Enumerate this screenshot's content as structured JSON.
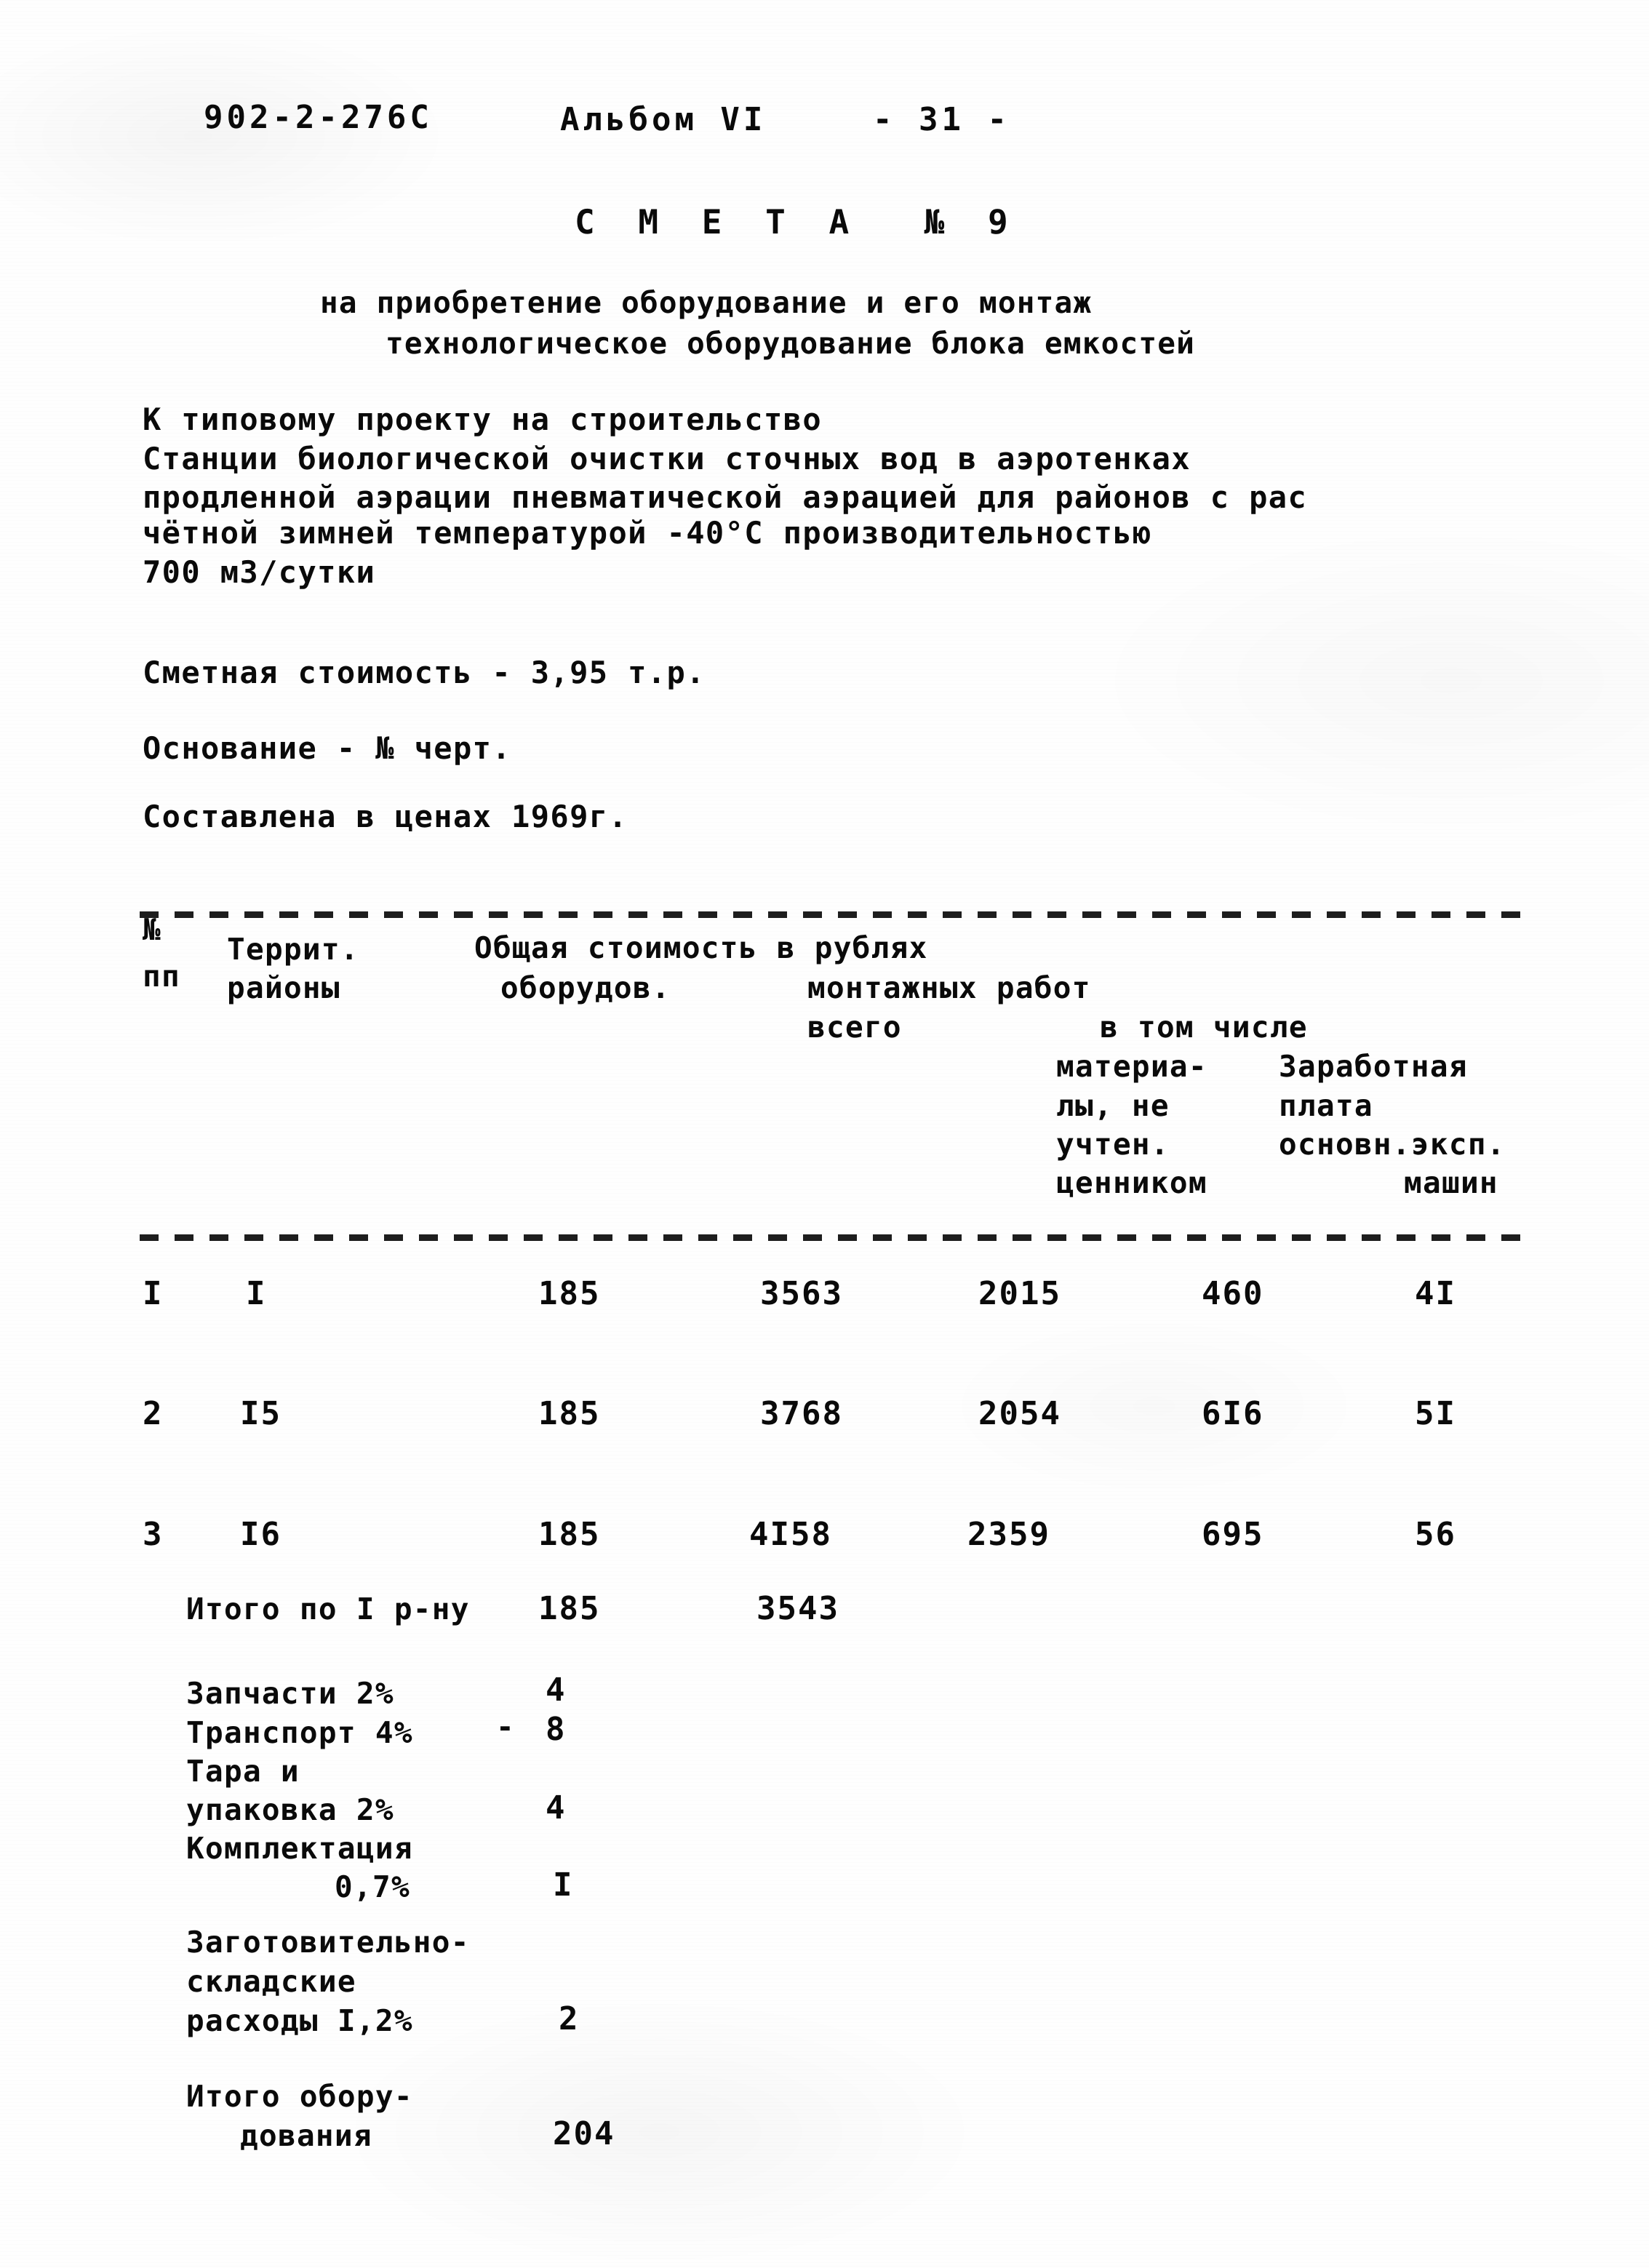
{
  "document": {
    "series_code": "902-2-276С",
    "album_label": "Альбом VI",
    "page_marker": "- 31 -",
    "title": "С М Е Т А  № 9",
    "subtitle_line1": "на приобретение оборудование и его монтаж",
    "subtitle_line2": "технологическое оборудование блока емкостей"
  },
  "preamble": {
    "line1": "К типовому проекту на строительство",
    "line2": "Станции биологической очистки сточных вод в аэротенках",
    "line3": "продленной аэрации пневматической аэрацией для районов с рас",
    "line4": "чётной зимней температурой -40°С производительностью",
    "line5": "700 м3/сутки"
  },
  "summary": {
    "estimate_cost": "Сметная стоимость - 3,95 т.р.",
    "basis": "Основание - № черт.",
    "prices_year": "Составлена в ценах 1969г."
  },
  "table": {
    "headers": {
      "num_line1": "№",
      "num_line2": "пп",
      "region_line1": "Террит.",
      "region_line2": "районы",
      "group_title": "Общая стоимость в рублях",
      "equipment": "оборудов.",
      "install_works": "монтажных работ",
      "total": "всего",
      "among_which": "в том числе",
      "materials_line1": "материа-",
      "materials_line2": "лы, не",
      "materials_line3": "учтен.",
      "materials_line4": "ценником",
      "wages_line1": "Заработная",
      "wages_line2": "плата",
      "wages_line3": "основн.эксп.",
      "wages_line4": "машин"
    },
    "rows": [
      {
        "num": "I",
        "region": "I",
        "equipment": "185",
        "total": "3563",
        "materials": "2015",
        "wages": "460",
        "machines": "4I"
      },
      {
        "num": "2",
        "region": "I5",
        "equipment": "185",
        "total": "3768",
        "materials": "2054",
        "wages": "6I6",
        "machines": "5I"
      },
      {
        "num": "3",
        "region": "I6",
        "equipment": "185",
        "total": "4I58",
        "materials": "2359",
        "wages": "695",
        "machines": "56"
      }
    ],
    "subtotal": {
      "label": "Итого по I р-ну",
      "equipment": "185",
      "total": "3543"
    },
    "additions": [
      {
        "label": "Запчасти 2%",
        "dash": "",
        "value": "4"
      },
      {
        "label": "Транспорт 4%",
        "dash": "-",
        "value": "8"
      },
      {
        "label_line1": "Тара и",
        "label_line2": "упаковка 2%",
        "value": "4"
      },
      {
        "label_line1": "Комплектация",
        "label_line2": "0,7%",
        "value": "I"
      }
    ],
    "procurement": {
      "line1": "Заготовительно-",
      "line2": "складские",
      "line3": "расходы I,2%",
      "value": "2"
    },
    "equipment_total": {
      "line1": "Итого обору-",
      "line2": "дования",
      "value": "204"
    }
  }
}
